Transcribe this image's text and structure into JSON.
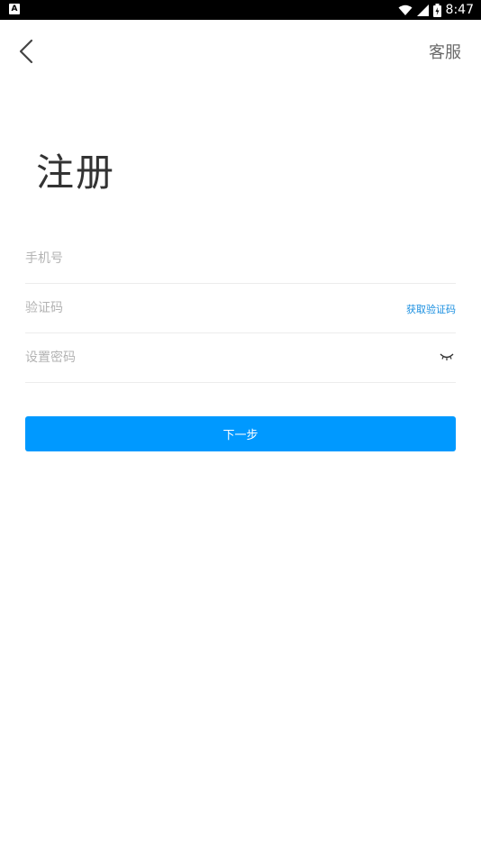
{
  "status_bar": {
    "left_icon_text": "A",
    "time": "8:47",
    "icons": [
      "wifi-icon",
      "signal-icon",
      "battery-icon"
    ]
  },
  "header": {
    "back_icon": "chevron-left-icon",
    "service_label": "客服"
  },
  "page": {
    "title": "注册"
  },
  "form": {
    "phone_placeholder": "手机号",
    "code_placeholder": "验证码",
    "get_code_label": "获取验证码",
    "password_placeholder": "设置密码",
    "password_toggle_icon": "eye-closed-icon",
    "next_label": "下一步"
  },
  "colors": {
    "accent": "#0099ff",
    "link": "#1a8fe0",
    "title": "#333333",
    "placeholder": "#b3b3b3"
  }
}
